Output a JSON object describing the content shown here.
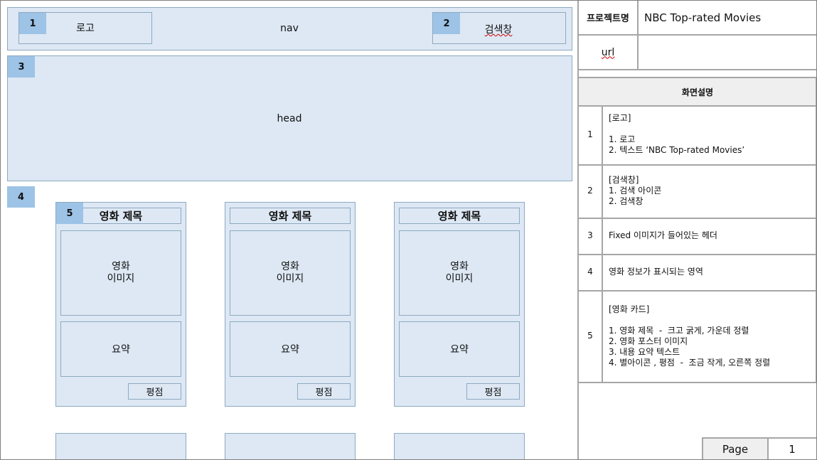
{
  "wireframe": {
    "nav": {
      "tag": "1",
      "logo_label": "로고",
      "label": "nav",
      "search_tag": "2",
      "search_label": "검색창"
    },
    "head": {
      "tag": "3",
      "label": "head"
    },
    "content": {
      "tag": "4",
      "card_tag": "5"
    },
    "cards": [
      {
        "title": "영화 제목",
        "image_line1": "영화",
        "image_line2": "이미지",
        "summary": "요약",
        "rating": "평점"
      },
      {
        "title": "영화 제목",
        "image_line1": "영화",
        "image_line2": "이미지",
        "summary": "요약",
        "rating": "평점"
      },
      {
        "title": "영화 제목",
        "image_line1": "영화",
        "image_line2": "이미지",
        "summary": "요약",
        "rating": "평점"
      }
    ]
  },
  "panel": {
    "project_label": "프로젝트명",
    "project_value": "NBC Top-rated Movies",
    "url_label": "url",
    "url_value": "",
    "section_title": "화면설명",
    "rows": [
      {
        "num": "1",
        "text": "[로고]\n\n1. 로고\n2. 텍스트 ‘NBC Top-rated Movies’"
      },
      {
        "num": "2",
        "text": "[검색창]\n1. 검색 아이콘\n2. 검색창"
      },
      {
        "num": "3",
        "text": "Fixed 이미지가 들어있는 헤더"
      },
      {
        "num": "4",
        "text": "영화 정보가 표시되는 영역"
      },
      {
        "num": "5",
        "text": "[영화 카드]\n\n1. 영화 제목  -  크고 굵게, 가운데 정렬\n2. 영화 포스터 이미지\n3. 내용 요약 텍스트\n4. 별아이콘 , 평점  -  조금 작게, 오른쪽 정렬"
      }
    ],
    "page_label": "Page",
    "page_number": "1"
  }
}
